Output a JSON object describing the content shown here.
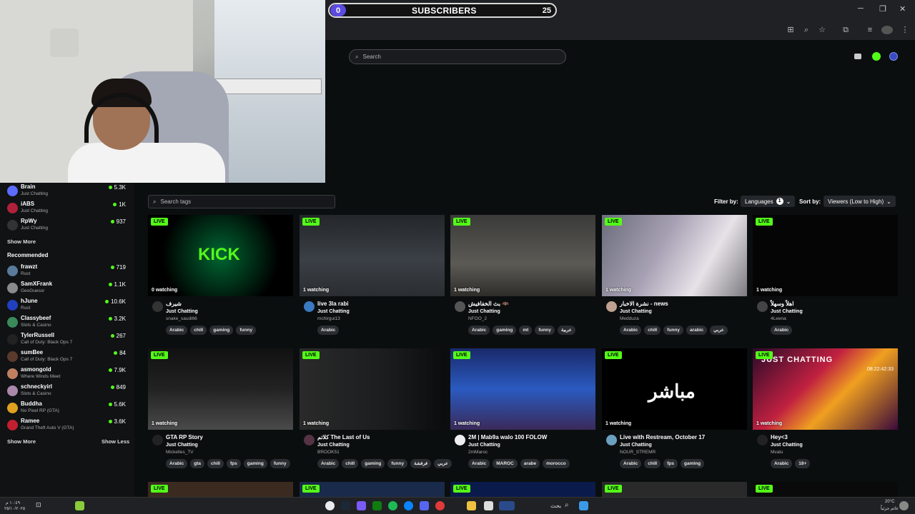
{
  "subscribers": {
    "count": "0",
    "label": "SUBSCRIBERS",
    "goal": "25"
  },
  "search": {
    "placeholder": "Search"
  },
  "sidebar": {
    "following": [
      {
        "name": "Brain",
        "category": "Just Chatting",
        "viewers": "5.3K",
        "color": "#5b6cff"
      },
      {
        "name": "iABS",
        "category": "Just Chatting",
        "viewers": "1K",
        "color": "#b0203a"
      },
      {
        "name": "RpWy",
        "category": "Just Chatting",
        "viewers": "937",
        "color": "#333333"
      }
    ],
    "show_more_1": "Show More",
    "recommended_heading": "Recommended",
    "recommended": [
      {
        "name": "frawzt",
        "category": "Rust",
        "viewers": "719",
        "color": "#5a7a9a"
      },
      {
        "name": "SamXFrank",
        "category": "GeoGuessr",
        "viewers": "1.1K",
        "color": "#8a8a8a"
      },
      {
        "name": "hJune",
        "category": "Rust",
        "viewers": "10.6K",
        "color": "#2040c0"
      },
      {
        "name": "Classybeef",
        "category": "Slots & Casino",
        "viewers": "3.2K",
        "color": "#3a8a5a"
      },
      {
        "name": "TylerRussell",
        "category": "Call of Duty: Black Ops 7",
        "viewers": "267",
        "color": "#222222"
      },
      {
        "name": "sumBee",
        "category": "Call of Duty: Black Ops 7",
        "viewers": "84",
        "color": "#5a3a2a"
      },
      {
        "name": "asmongold",
        "category": "Where Winds Meet",
        "viewers": "7.9K",
        "color": "#c08060"
      },
      {
        "name": "schneckyirl",
        "category": "Slots & Casino",
        "viewers": "849",
        "color": "#aa88aa"
      },
      {
        "name": "Buddha",
        "category": "No Pixel RP (GTA)",
        "viewers": "5.6K",
        "color": "#e0a020"
      },
      {
        "name": "Ramee",
        "category": "Grand Theft Auto V (GTA)",
        "viewers": "3.6K",
        "color": "#c02030"
      }
    ],
    "show_more_2": "Show More",
    "show_less": "Show Less"
  },
  "filters": {
    "tag_search_placeholder": "Search tags",
    "filter_by_label": "Filter by:",
    "languages_label": "Languages",
    "languages_count": "1",
    "sort_by_label": "Sort by:",
    "sort_value": "Viewers (Low to High)"
  },
  "cards": [
    {
      "live": "LIVE",
      "watching": "0 watching",
      "title": "شيرف",
      "category": "Just Chatting",
      "user": "snake_saudi66",
      "tags": [
        "Arabic",
        "chill",
        "gaming",
        "funny"
      ],
      "thumb": "kick",
      "avatar": "#333333"
    },
    {
      "live": "LIVE",
      "watching": "1 watching",
      "title": "live 3la rabi",
      "category": "Just Chatting",
      "user": "mchirgui13",
      "tags": [
        "Arabic"
      ],
      "thumb": "gta",
      "avatar": "#3a7ac0"
    },
    {
      "live": "LIVE",
      "watching": "1 watching",
      "title": "بث الخفافيش 🦇",
      "category": "Just Chatting",
      "user": "NFOO_2",
      "tags": [
        "Arabic",
        "gaming",
        "mt",
        "funny",
        "عربية"
      ],
      "thumb": "dark",
      "avatar": "#555555"
    },
    {
      "live": "LIVE",
      "watching": "1 watching",
      "title": "نشرة الاخبار - news",
      "category": "Just Chatting",
      "user": "Medduza",
      "tags": [
        "Arabic",
        "chill",
        "funny",
        "arabic",
        "عربي"
      ],
      "thumb": "room",
      "avatar": "#c0a090"
    },
    {
      "live": "LIVE",
      "watching": "1 watching",
      "title": "اهلاً وسهلاً",
      "category": "Just Chatting",
      "user": "4Leena",
      "tags": [
        "Arabic"
      ],
      "thumb": "black",
      "avatar": "#444444"
    },
    {
      "live": "LIVE",
      "watching": "1 watching",
      "title": "GTA RP Story",
      "category": "Just Chatting",
      "user": "Mickelles_TV",
      "tags": [
        "Arabic",
        "gta",
        "chill",
        "fps",
        "gaming",
        "funny"
      ],
      "thumb": "night",
      "avatar": "#222222"
    },
    {
      "live": "LIVE",
      "watching": "1 watching",
      "title": "كلاتم The Last of Us",
      "category": "Just Chatting",
      "user": "BROOK51",
      "tags": [
        "Arabic",
        "chill",
        "gaming",
        "funny",
        "فرفشة",
        "عربي"
      ],
      "thumb": "tlou",
      "avatar": "#553344"
    },
    {
      "live": "LIVE",
      "watching": "1 watching",
      "title": "2M | Mab9a walo 100 FOLOW",
      "category": "Just Chatting",
      "user": "2mMaroc",
      "tags": [
        "Arabic",
        "MAROC",
        "arabe",
        "morocco"
      ],
      "thumb": "tv",
      "avatar": "#eeeeee"
    },
    {
      "live": "LIVE",
      "watching": "1 watching",
      "title": "Live with Restream, October 17",
      "category": "Just Chatting",
      "user": "NOUR_STREMR",
      "tags": [
        "Arabic",
        "chill",
        "fps",
        "gaming"
      ],
      "thumb": "mubashir",
      "avatar": "#6aa0c0"
    },
    {
      "live": "LIVE",
      "watching": "1 watching",
      "title": "Hey<3",
      "category": "Just Chatting",
      "user": "Mvalu",
      "tags": [
        "Arabic",
        "18+"
      ],
      "thumb": "anime",
      "avatar": "#222222"
    }
  ],
  "thumb_texts": {
    "kick": "KICK",
    "mubashir": "مباشر",
    "anime": "JUST CHATTING",
    "anime_clock": "08:22:42:33"
  },
  "bottom_live": [
    "LIVE",
    "LIVE",
    "LIVE",
    "LIVE",
    "LIVE"
  ],
  "taskbar": {
    "left_time": "١٠:٤٩ م",
    "left_date": "٢٥/١٠/٢٠٢٥",
    "search_label": "بحث",
    "weather_temp": "20°C",
    "weather_desc": "غائم جزئياً"
  }
}
